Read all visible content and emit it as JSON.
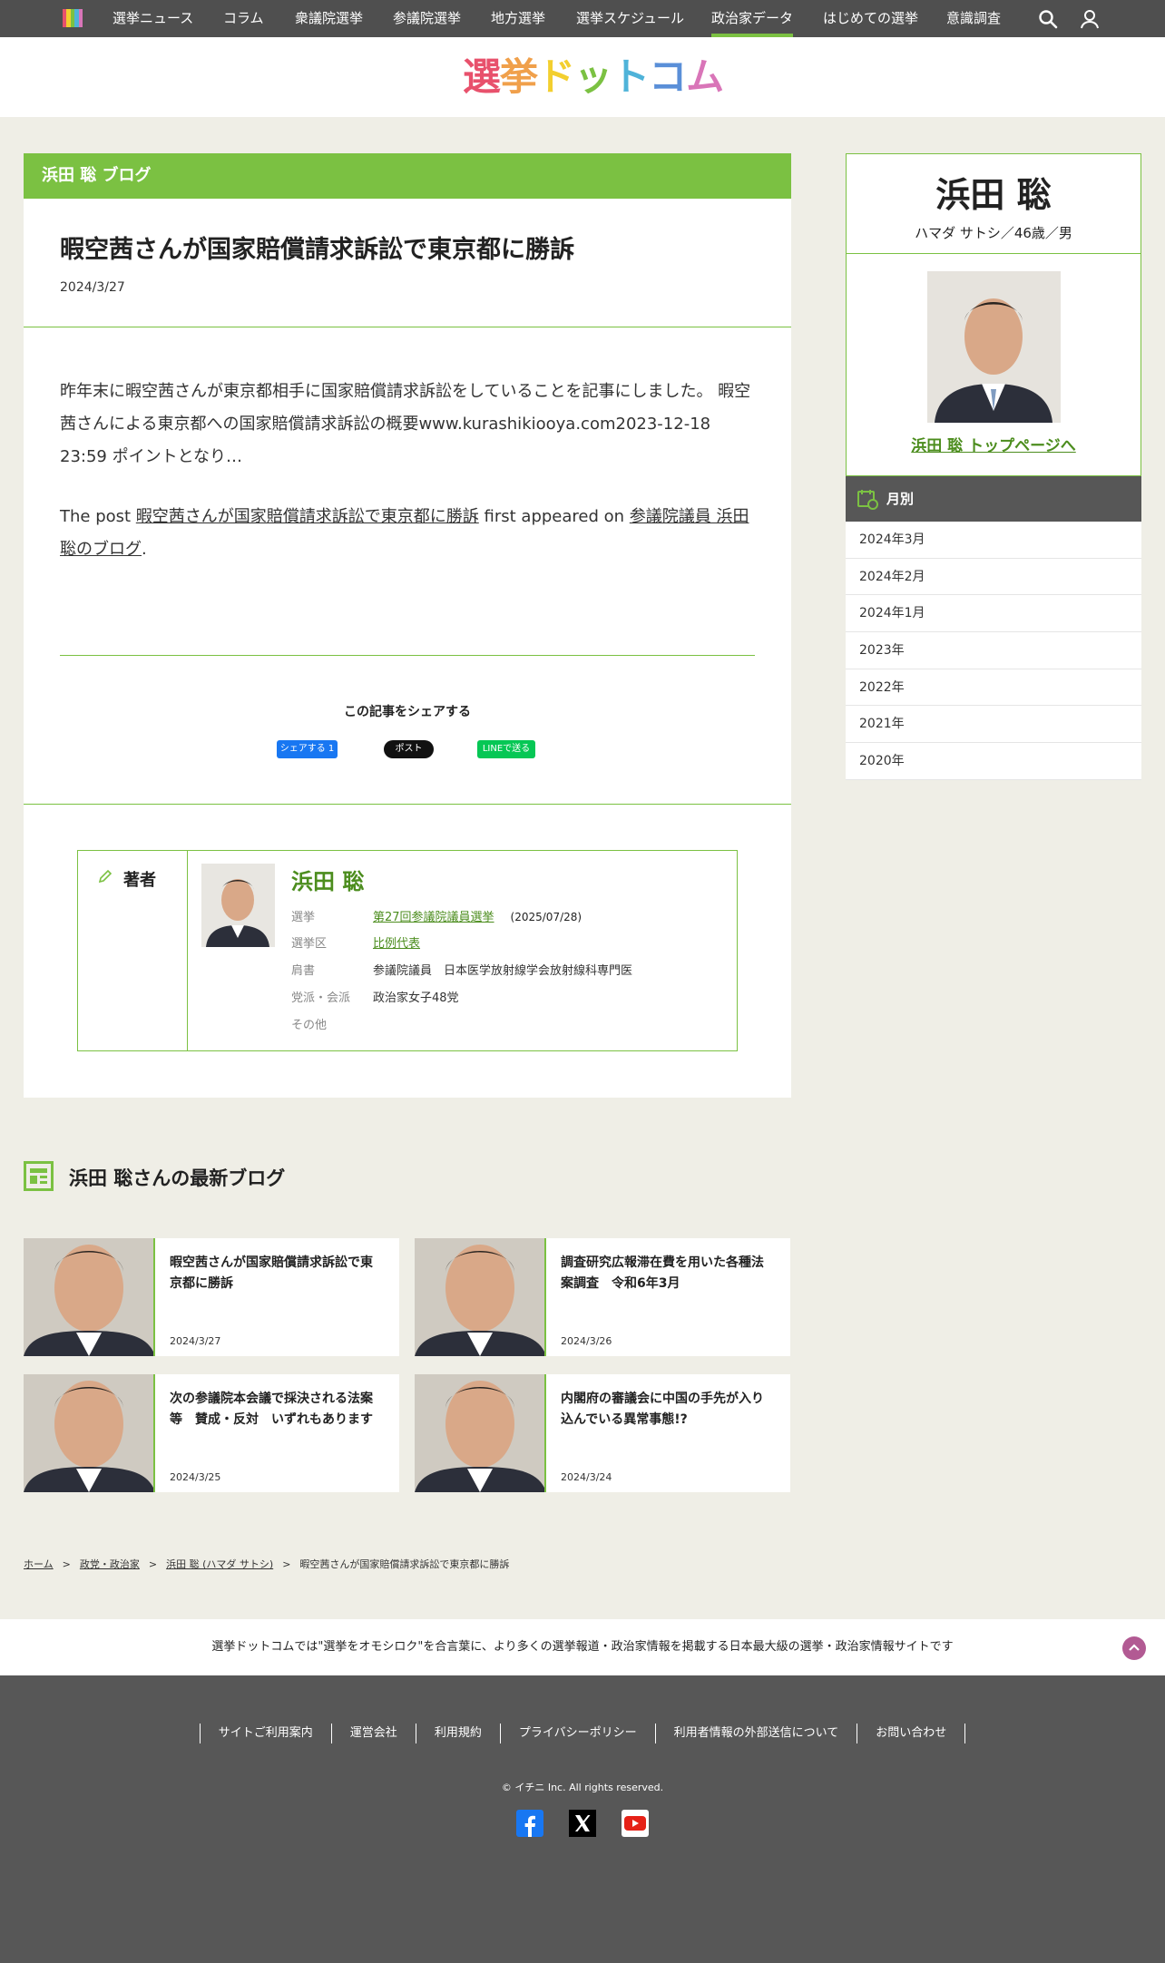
{
  "nav": {
    "items": [
      "選挙ニュース",
      "コラム",
      "衆議院選挙",
      "参議院選挙",
      "地方選挙",
      "選挙スケジュール",
      "政治家データ",
      "はじめての選挙",
      "意識調査"
    ],
    "active_index": 6
  },
  "logo": {
    "text": [
      "選",
      "挙",
      "ド",
      "ッ",
      "ト",
      "コ",
      "ム"
    ]
  },
  "article": {
    "blog_header": "浜田 聡 ブログ",
    "title": "暇空茜さんが国家賠償請求訴訟で東京都に勝訴",
    "date": "2024/3/27",
    "para1": "昨年末に暇空茜さんが東京都相手に国家賠償請求訴訟をしていることを記事にしました。 暇空茜さんによる東京都への国家賠償請求訴訟の概要www.kurashikiooya.com2023-12-18 23:59 ポイントとなり…",
    "para2_prefix": "The post ",
    "para2_link1": "暇空茜さんが国家賠償請求訴訟で東京都に勝訴",
    "para2_mid": " first appeared on ",
    "para2_link2": "参議院議員 浜田聡のブログ",
    "para2_suffix": ".",
    "share_title": "この記事をシェアする",
    "share_fb": "シェアする 1",
    "share_x": "ポスト",
    "share_line": "LINEで送る"
  },
  "author": {
    "label": "著者",
    "name": "浜田 聡",
    "rows": [
      {
        "k": "選挙",
        "v": "第27回参議院議員選挙",
        "extra": "(2025/07/28)",
        "link": true
      },
      {
        "k": "選挙区",
        "v": "比例代表",
        "extra": "",
        "link": true
      },
      {
        "k": "肩書",
        "v": "参議院議員　日本医学放射線学会放射線科専門医",
        "extra": "",
        "link": false
      },
      {
        "k": "党派・会派",
        "v": "政治家女子48党",
        "extra": "",
        "link": false
      },
      {
        "k": "その他",
        "v": "",
        "extra": "",
        "link": false
      }
    ]
  },
  "sidebar": {
    "name": "浜田 聡",
    "sub": "ハマダ サトシ／46歳／男",
    "toplink": "浜田 聡 トップページへ",
    "month_head": "月別",
    "months": [
      "2024年3月",
      "2024年2月",
      "2024年1月",
      "2023年",
      "2022年",
      "2021年",
      "2020年"
    ]
  },
  "latest": {
    "title": "浜田 聡さんの最新ブログ",
    "posts": [
      {
        "title": "暇空茜さんが国家賠償請求訴訟で東京都に勝訴",
        "date": "2024/3/27"
      },
      {
        "title": "調査研究広報滞在費を用いた各種法案調査　令和6年3月",
        "date": "2024/3/26"
      },
      {
        "title": "次の参議院本会議で採決される法案等　賛成・反対　いずれもあります",
        "date": "2024/3/25"
      },
      {
        "title": "内閣府の審議会に中国の手先が入り込んでいる異常事態!?",
        "date": "2024/3/24"
      }
    ]
  },
  "breadcrumb": [
    "ホーム",
    "政党・政治家",
    "浜田 聡 (ハマダ サトシ)",
    "暇空茜さんが国家賠償請求訴訟で東京都に勝訴"
  ],
  "footer": {
    "tagline": "選挙ドットコムでは\"選挙をオモシロク\"を合言葉に、より多くの選挙報道・政治家情報を掲載する日本最大級の選挙・政治家情報サイトです",
    "links": [
      "サイトご利用案内",
      "運営会社",
      "利用規約",
      "プライバシーポリシー",
      "利用者情報の外部送信について",
      "お問い合わせ"
    ],
    "copyright": "© イチニ Inc. All rights reserved.",
    "social": [
      "facebook-icon",
      "x-icon",
      "youtube-icon"
    ]
  },
  "colors": {
    "accent": "#7bc142",
    "accent_dark": "#4c8d1e",
    "nav_bg": "#4f4f4f",
    "page_bg": "#efeee6"
  }
}
